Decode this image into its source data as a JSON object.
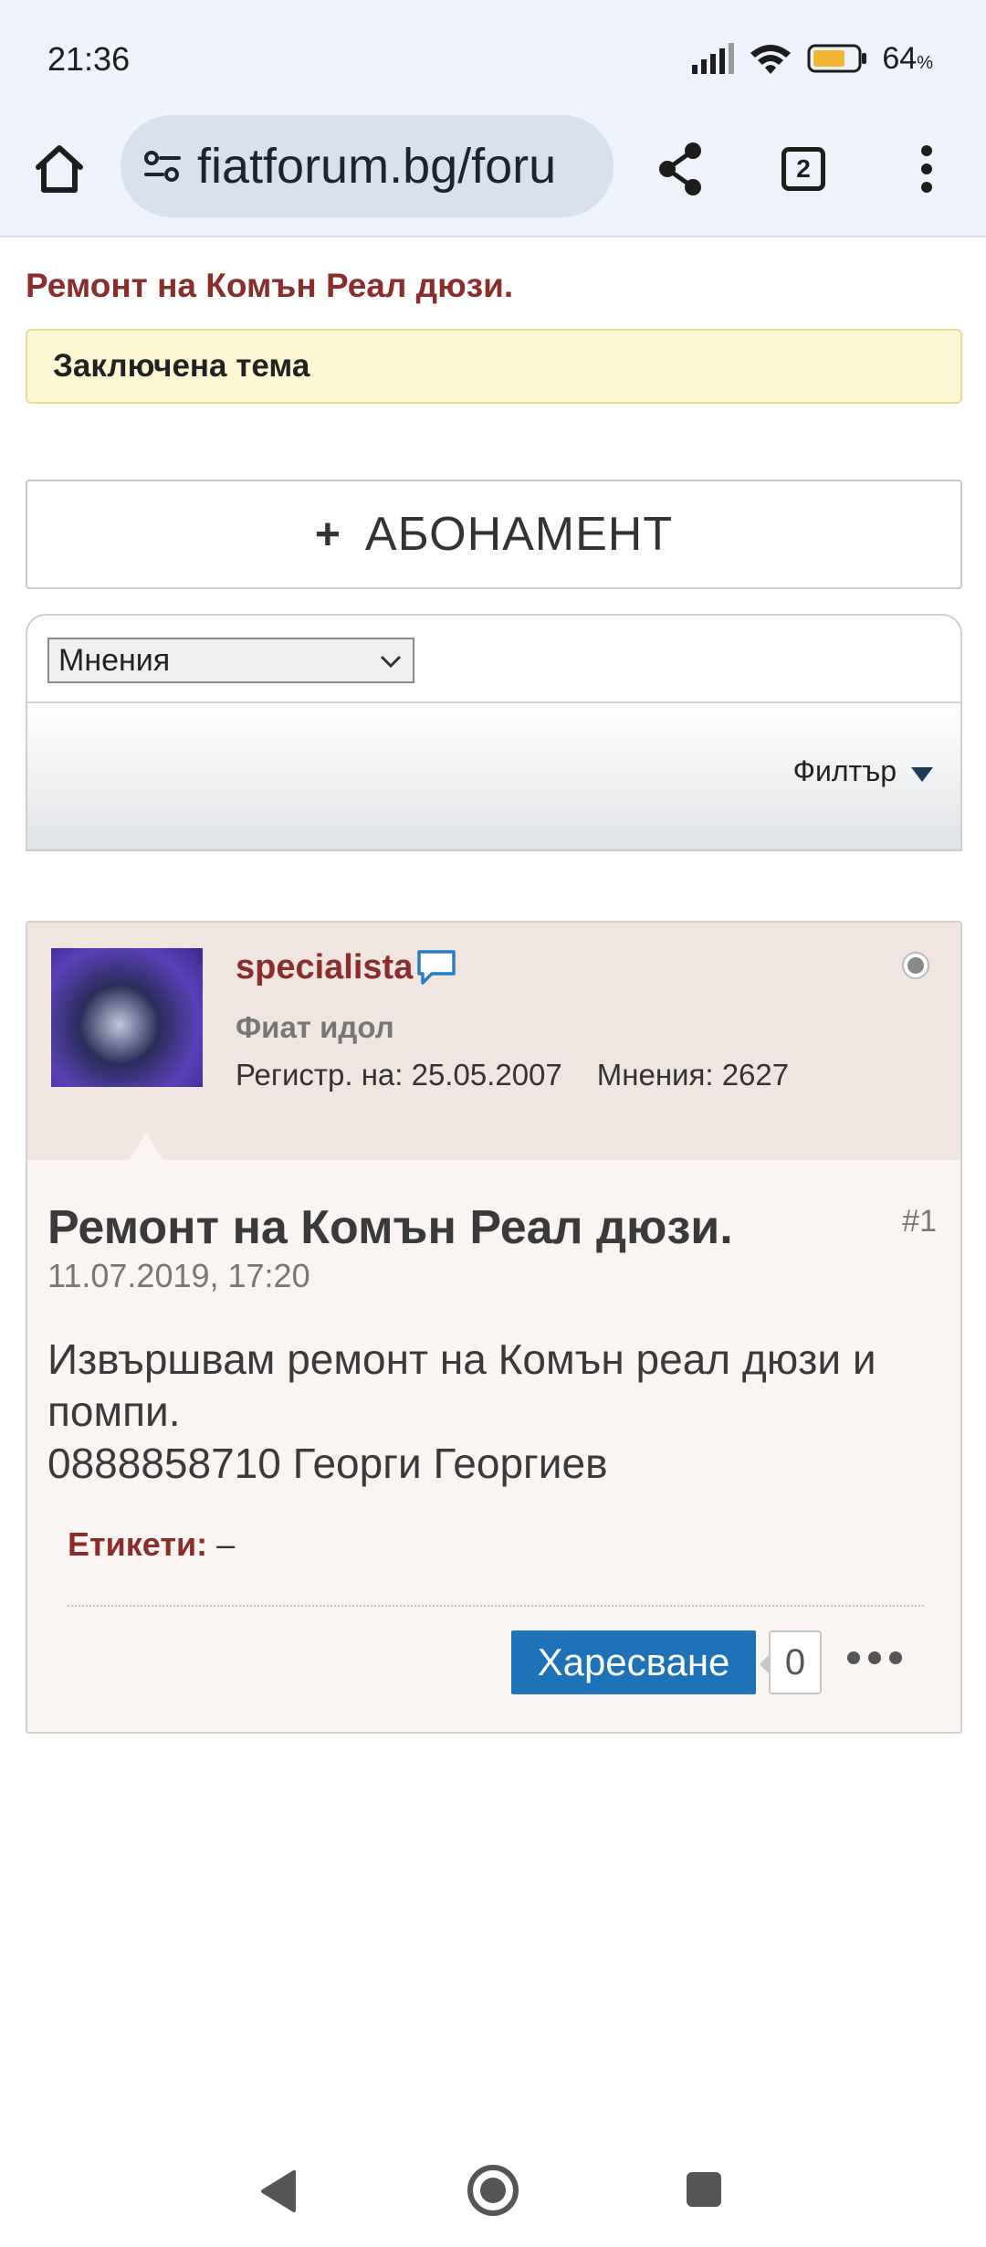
{
  "status_bar": {
    "time": "21:36",
    "battery_percent": "64",
    "battery_unit": "%"
  },
  "browser": {
    "url": "fiatforum.bg/foru",
    "tab_count": "2"
  },
  "thread": {
    "title": "Ремонт на Комън Реал дюзи.",
    "locked_notice": "Заключена тема",
    "subscribe_plus": "+",
    "subscribe_label": "АБОНАМЕНТ",
    "select_value": "Мнения",
    "filter_label": "Филтър"
  },
  "post": {
    "username": "specialista",
    "rank": "Фиат идол",
    "registered": "Регистр. на: 25.05.2007",
    "posts_count": "Мнения: 2627",
    "title": "Ремонт на Комън Реал дюзи.",
    "number": "#1",
    "date": "11.07.2019, 17:20",
    "body_line1": "Извършвам ремонт на Комън реал дюзи и помпи.",
    "body_line2": "0888858710 Георги Георгиев",
    "tags_label": "Етикети:",
    "tags_value": " –",
    "like_label": "Харесване",
    "like_count": "0"
  },
  "colors": {
    "accent_red": "#8b2d2d",
    "like_blue": "#1e72b8",
    "locked_bg": "#fdf8d3",
    "battery_fill": "#f2b431"
  },
  "icons": [
    "home-icon",
    "site-settings-icon",
    "share-icon",
    "tabs-icon",
    "more-vert-icon",
    "chat-bubble-icon",
    "signal-icon",
    "wifi-icon",
    "battery-icon",
    "back-icon",
    "home-circle-icon",
    "recents-icon"
  ]
}
